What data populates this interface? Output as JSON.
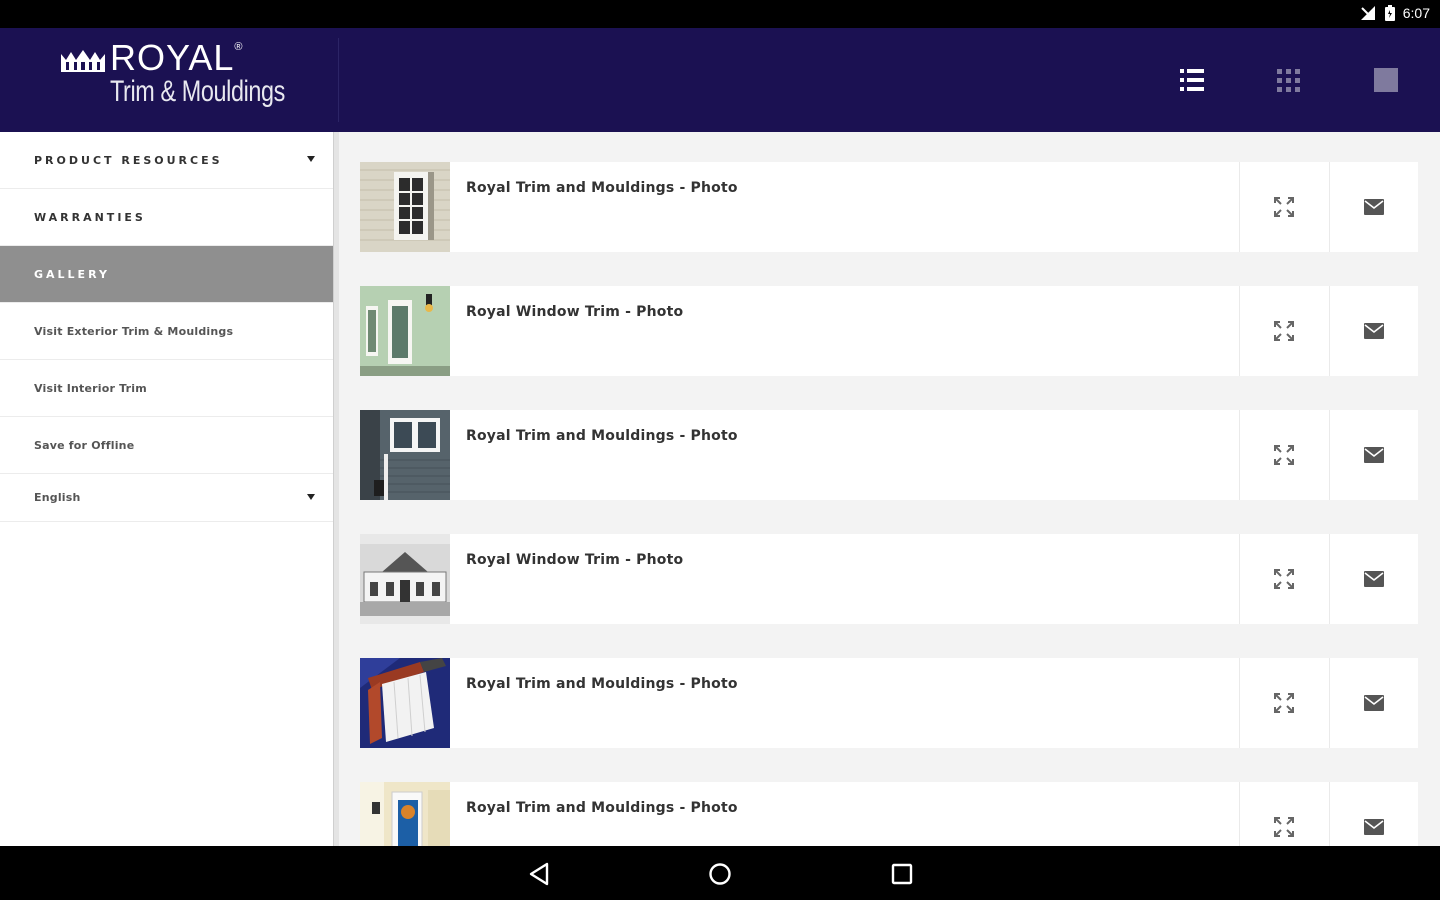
{
  "status_bar": {
    "time": "6:07",
    "icons": [
      "signal-icon",
      "battery-icon"
    ]
  },
  "app": {
    "brand": "ROYAL",
    "brand_mark": "®",
    "tagline": "Trim & Mouldings",
    "brand_color": "#1b1152"
  },
  "toolbar": {
    "buttons": [
      "list-view-icon",
      "grid-view-icon",
      "single-view-icon"
    ]
  },
  "sidebar": {
    "items": [
      {
        "label": "PRODUCT RESOURCES",
        "dropdown": true
      },
      {
        "label": "WARRANTIES"
      },
      {
        "label": "GALLERY",
        "active": true
      },
      {
        "label": "Visit Exterior Trim & Mouldings"
      },
      {
        "label": "Visit Interior Trim"
      },
      {
        "label": "Save for Offline"
      },
      {
        "label": "English",
        "dropdown": true
      }
    ],
    "active_color": "#8f8f8f"
  },
  "gallery": {
    "items": [
      {
        "title": "Royal Trim and Mouldings - Photo"
      },
      {
        "title": "Royal Window Trim - Photo"
      },
      {
        "title": "Royal Trim and Mouldings - Photo"
      },
      {
        "title": "Royal Window Trim - Photo"
      },
      {
        "title": "Royal Trim and Mouldings - Photo"
      },
      {
        "title": "Royal Trim and Mouldings - Photo"
      }
    ],
    "actions": [
      "expand-icon",
      "mail-icon"
    ]
  },
  "navigation_bar": {
    "buttons": [
      "back-icon",
      "home-icon",
      "recents-icon"
    ]
  }
}
